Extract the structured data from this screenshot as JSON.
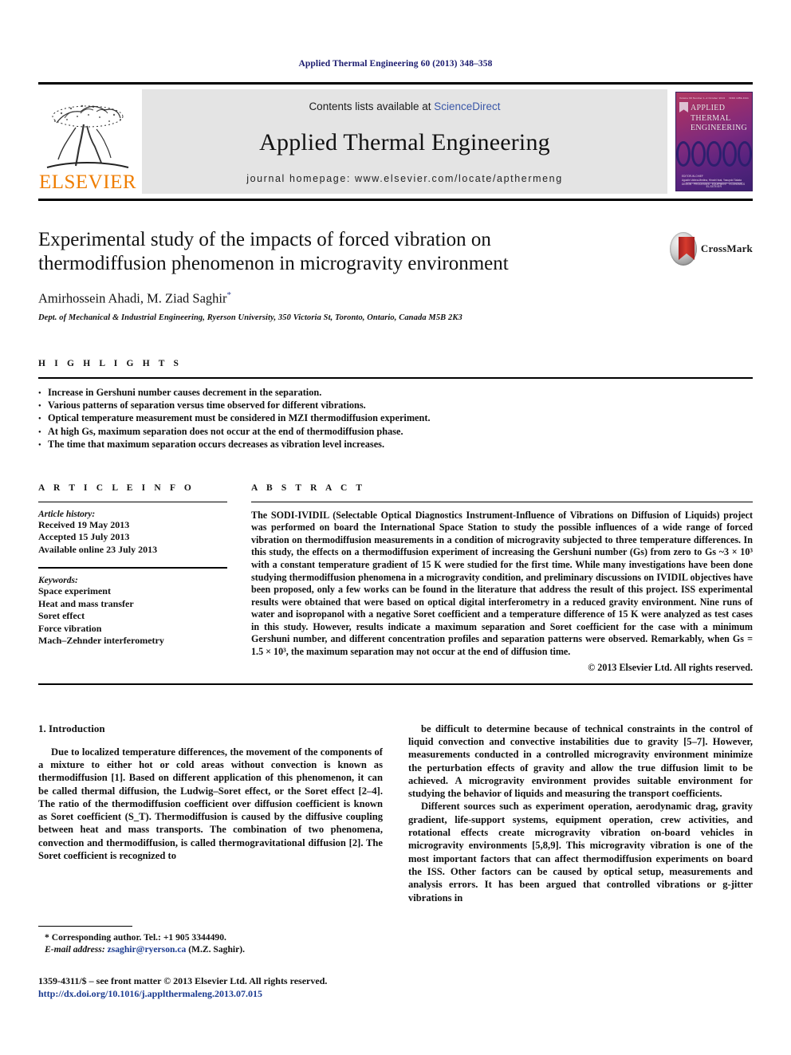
{
  "running_head": "Applied Thermal Engineering 60 (2013) 348–358",
  "masthead": {
    "publisher_wordmark": "ELSEVIER",
    "contents_prefix": "Contents lists available at ",
    "contents_link": "ScienceDirect",
    "journal_name": "Applied Thermal Engineering",
    "homepage_label": "journal homepage: www.elsevier.com/locate/apthermeng",
    "cover": {
      "top_left": "Volume 60  Number 1–2  October 2013",
      "top_right": "ISSN 1359-4311",
      "title_line1": "APPLIED",
      "title_line2": "THERMAL",
      "title_line3": "ENGINEERING",
      "authors_line1": "EDITOR-IN-CHIEF",
      "authors_line2": "Agustin Valera-Medina, Hiroshi Iwai, Yasuyuki Takata",
      "authors_line3": "DESIGN · PROCESSES · EQUIPMENT · ECONOMICS",
      "footer": "ELSEVIER"
    }
  },
  "article": {
    "title": "Experimental study of the impacts of forced vibration on thermodiffusion phenomenon in microgravity environment",
    "authors": "Amirhossein Ahadi, M. Ziad Saghir",
    "author_marker": "*",
    "affiliation": "Dept. of Mechanical & Industrial Engineering, Ryerson University, 350 Victoria St, Toronto, Ontario, Canada M5B 2K3",
    "crossmark_label": "CrossMark"
  },
  "highlights": {
    "heading": "H I G H L I G H T S",
    "items": [
      "Increase in Gershuni number causes decrement in the separation.",
      "Various patterns of separation versus time observed for different vibrations.",
      "Optical temperature measurement must be considered in MZI thermodiffusion experiment.",
      "At high Gs, maximum separation does not occur at the end of thermodiffusion phase.",
      "The time that maximum separation occurs decreases as vibration level increases."
    ]
  },
  "article_info": {
    "heading": "A R T I C L E   I N F O",
    "history_label": "Article history:",
    "history": [
      "Received 19 May 2013",
      "Accepted 15 July 2013",
      "Available online 23 July 2013"
    ],
    "keywords_label": "Keywords:",
    "keywords": [
      "Space experiment",
      "Heat and mass transfer",
      "Soret effect",
      "Force vibration",
      "Mach–Zehnder interferometry"
    ]
  },
  "abstract": {
    "heading": "A B S T R A C T",
    "text": "The SODI-IVIDIL (Selectable Optical Diagnostics Instrument-Influence of Vibrations on Diffusion of Liquids) project was performed on board the International Space Station to study the possible influences of a wide range of forced vibration on thermodiffusion measurements in a condition of microgravity subjected to three temperature differences. In this study, the effects on a thermodiffusion experiment of increasing the Gershuni number (Gs) from zero to Gs ~3 × 10³ with a constant temperature gradient of 15 K were studied for the first time. While many investigations have been done studying thermodiffusion phenomena in a microgravity condition, and preliminary discussions on IVIDIL objectives have been proposed, only a few works can be found in the literature that address the result of this project. ISS experimental results were obtained that were based on optical digital interferometry in a reduced gravity environment. Nine runs of water and isopropanol with a negative Soret coefficient and a temperature difference of 15 K were analyzed as test cases in this study. However, results indicate a maximum separation and Soret coefficient for the case with a minimum Gershuni number, and different concentration profiles and separation patterns were observed. Remarkably, when Gs = 1.5 × 10³, the maximum separation may not occur at the end of diffusion time.",
    "copyright": "© 2013 Elsevier Ltd. All rights reserved."
  },
  "body": {
    "section_heading": "1. Introduction",
    "left_paragraph_1": "Due to localized temperature differences, the movement of the components of a mixture to either hot or cold areas without convection is known as thermodiffusion [1]. Based on different application of this phenomenon, it can be called thermal diffusion, the Ludwig–Soret effect, or the Soret effect [2–4]. The ratio of the thermodiffusion coefficient over diffusion coefficient is known as Soret coefficient (S_T). Thermodiffusion is caused by the diffusive coupling between heat and mass transports. The combination of two phenomena, convection and thermodiffusion, is called thermogravitational diffusion [2]. The Soret coefficient is recognized to",
    "right_paragraph_1": "be difficult to determine because of technical constraints in the control of liquid convection and convective instabilities due to gravity [5–7]. However, measurements conducted in a controlled microgravity environment minimize the perturbation effects of gravity and allow the true diffusion limit to be achieved. A microgravity environment provides suitable environment for studying the behavior of liquids and measuring the transport coefficients.",
    "right_paragraph_2": "Different sources such as experiment operation, aerodynamic drag, gravity gradient, life-support systems, equipment operation, crew activities, and rotational effects create microgravity vibration on-board vehicles in microgravity environments [5,8,9]. This microgravity vibration is one of the most important factors that can affect thermodiffusion experiments on board the ISS. Other factors can be caused by optical setup, measurements and analysis errors. It has been argued that controlled vibrations or g-jitter vibrations in"
  },
  "footnote": {
    "corresponding": "* Corresponding author. Tel.: +1 905 3344490.",
    "email_label": "E-mail address:",
    "email": "zsaghir@ryerson.ca",
    "email_suffix": "(M.Z. Saghir)."
  },
  "footer": {
    "issn_line": "1359-4311/$ – see front matter © 2013 Elsevier Ltd. All rights reserved.",
    "doi_line": "http://dx.doi.org/10.1016/j.applthermaleng.2013.07.015"
  },
  "colors": {
    "link_blue": "#3a57a8",
    "reference_blue": "#1a3a8f",
    "elsevier_orange": "#ef7d00",
    "running_head_navy": "#1a1a6e",
    "band_gray": "#e4e4e4"
  }
}
